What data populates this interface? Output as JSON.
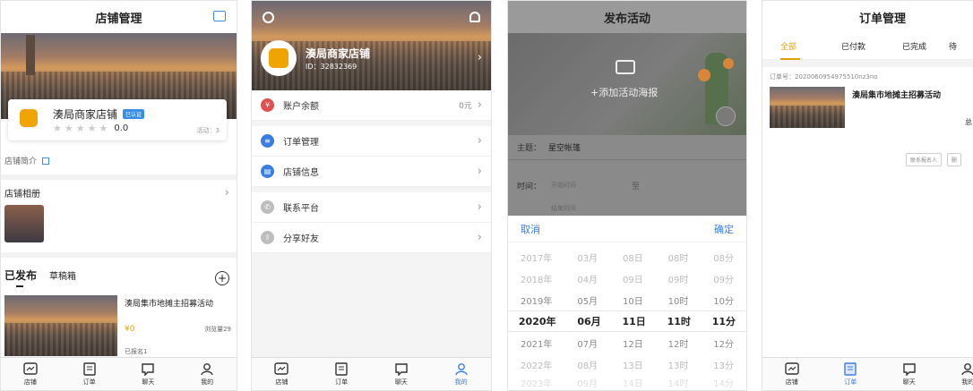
{
  "screen1": {
    "title": "店铺管理",
    "shop_name": "湊局商家店铺",
    "verified_badge": "已认证",
    "rating": "0.0",
    "activity_count": "活动：3",
    "intro_label": "店铺简介",
    "album_label": "店铺相册",
    "tab_published": "已发布",
    "tab_drafts": "草稿箱",
    "activity_title": "湊局集市地摊主招募活动",
    "price": "¥0",
    "views": "浏览量29",
    "signed_up": "已报名1"
  },
  "screen2": {
    "shop_name": "湊局商家店铺",
    "shop_id": "ID：32832369",
    "balance_label": "账户余额",
    "balance_value": "0元",
    "menu": [
      {
        "label": "订单管理",
        "color": "#3b7de0"
      },
      {
        "label": "店铺信息",
        "color": "#3b7de0"
      },
      {
        "label": "联系平台",
        "color": "#bdbdbd"
      },
      {
        "label": "分享好友",
        "color": "#bdbdbd"
      }
    ]
  },
  "screen3": {
    "title": "发布活动",
    "add_poster": "+添加活动海报",
    "subject_label": "主题：",
    "subject_value": "星空帐篷",
    "time_label": "时间：",
    "start_placeholder": "开始时间",
    "to": "至",
    "end_placeholder": "结束时间",
    "cancel": "取消",
    "confirm": "确定",
    "picker_rows": [
      [
        "2017年",
        "03月",
        "08日",
        "08时",
        "08分"
      ],
      [
        "2018年",
        "04月",
        "09日",
        "09时",
        "09分"
      ],
      [
        "2019年",
        "05月",
        "10日",
        "10时",
        "10分"
      ],
      [
        "2020年",
        "06月",
        "11日",
        "11时",
        "11分"
      ],
      [
        "2021年",
        "07月",
        "12日",
        "12时",
        "12分"
      ],
      [
        "2022年",
        "08月",
        "13日",
        "13时",
        "13分"
      ],
      [
        "2023年",
        "09月",
        "14日",
        "14时",
        "14分"
      ]
    ],
    "selected_row": 3
  },
  "screen4": {
    "title": "订单管理",
    "tabs": [
      "全部",
      "已付款",
      "已完成",
      "待"
    ],
    "active_tab": 0,
    "order_no": "订单号：2020060954975510nz3no",
    "order_title": "湊局集市地摊主招募活动",
    "total_label": "总",
    "btn_contact": "联系报名人",
    "btn_more": "删"
  },
  "tabbar": {
    "shop": "店铺",
    "order": "订单",
    "chat": "聊天",
    "mine": "我的"
  },
  "colors": {
    "accent": "#e6a100",
    "blue": "#3b7de0",
    "link_blue": "#3c8be0"
  }
}
